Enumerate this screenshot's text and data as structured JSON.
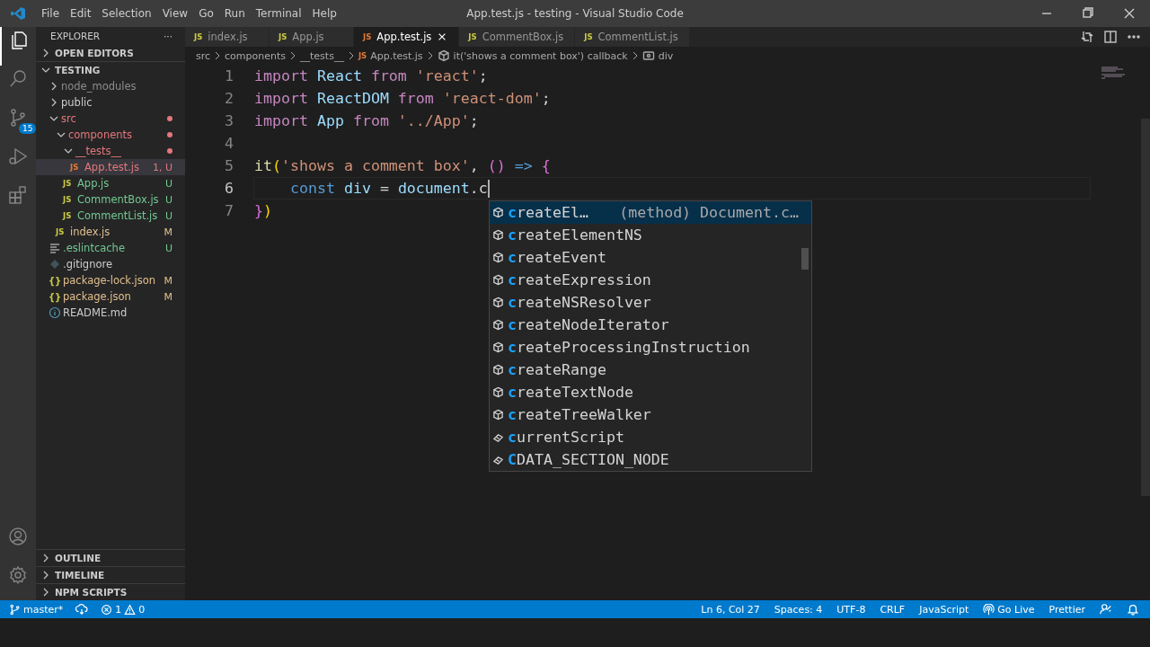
{
  "title_bar": {
    "menu": [
      "File",
      "Edit",
      "Selection",
      "View",
      "Go",
      "Run",
      "Terminal",
      "Help"
    ],
    "title": "App.test.js - testing - Visual Studio Code"
  },
  "activity_bar": {
    "items": [
      {
        "kind": "files",
        "selected": true
      },
      {
        "kind": "search",
        "selected": false
      },
      {
        "kind": "scm",
        "selected": false,
        "badge": "15"
      },
      {
        "kind": "run",
        "selected": false
      },
      {
        "kind": "extensions",
        "selected": false
      }
    ]
  },
  "sidebar": {
    "title": "EXPLORER",
    "more": "···",
    "open_editors": {
      "label": "OPEN EDITORS",
      "expanded": false
    },
    "root": {
      "label": "TESTING",
      "expanded": true,
      "children": [
        {
          "label": "node_modules",
          "kind": "folder",
          "expanded": false,
          "color": "#8c8c8c",
          "dot": false
        },
        {
          "label": "public",
          "kind": "folder",
          "expanded": false,
          "color": "#cccccc",
          "dot": false
        },
        {
          "label": "src",
          "kind": "folder",
          "expanded": true,
          "color": "#e4787c",
          "dot": true,
          "children": [
            {
              "label": "components",
              "kind": "folder",
              "expanded": true,
              "color": "#e4787c",
              "dot": true,
              "children": [
                {
                  "label": "__tests__",
                  "kind": "folder",
                  "expanded": true,
                  "color": "#e4787c",
                  "dot": true,
                  "children": [
                    {
                      "label": "App.test.js",
                      "kind": "js",
                      "icon_label": "JS",
                      "color": "#e4787c",
                      "selected": true,
                      "badge": "1, U"
                    }
                  ]
                },
                {
                  "label": "App.js",
                  "kind": "js",
                  "icon_label": "JS",
                  "color": "#73c991",
                  "selected": false,
                  "badge": "U"
                },
                {
                  "label": "CommentBox.js",
                  "kind": "js",
                  "icon_label": "JS",
                  "color": "#73c991",
                  "selected": false,
                  "badge": "U"
                },
                {
                  "label": "CommentList.js",
                  "kind": "js",
                  "icon_label": "JS",
                  "color": "#73c991",
                  "selected": false,
                  "badge": "U"
                }
              ]
            },
            {
              "label": "index.js",
              "kind": "js",
              "icon_label": "JS",
              "color": "#e2c08d",
              "selected": false,
              "badge": "M"
            }
          ]
        },
        {
          "label": ".eslintcache",
          "kind": "lines",
          "color": "#73c991",
          "selected": false,
          "badge": "U"
        },
        {
          "label": ".gitignore",
          "kind": "gitignore",
          "color": "#cccccc",
          "selected": false
        },
        {
          "label": "package-lock.json",
          "kind": "json",
          "icon_label": "{}",
          "color": "#e2c08d",
          "selected": false,
          "badge": "M"
        },
        {
          "label": "package.json",
          "kind": "json",
          "icon_label": "{}",
          "color": "#e2c08d",
          "selected": false,
          "badge": "M"
        },
        {
          "label": "README.md",
          "kind": "info",
          "color": "#cccccc",
          "selected": false
        }
      ]
    },
    "sections": [
      {
        "label": "OUTLINE",
        "expanded": false
      },
      {
        "label": "TIMELINE",
        "expanded": false
      },
      {
        "label": "NPM SCRIPTS",
        "expanded": false
      }
    ]
  },
  "tabs": [
    {
      "label": "index.js",
      "icon_label": "JS",
      "selected": false
    },
    {
      "label": "App.js",
      "icon_label": "JS",
      "selected": false
    },
    {
      "label": "App.test.js",
      "icon_label": "JS",
      "selected": true
    },
    {
      "label": "CommentBox.js",
      "icon_label": "JS",
      "selected": false
    },
    {
      "label": "CommentList.js",
      "icon_label": "JS",
      "selected": false
    }
  ],
  "breadcrumbs": [
    {
      "label": "src",
      "kind": "folder"
    },
    {
      "label": "components",
      "kind": "folder"
    },
    {
      "label": "__tests__",
      "kind": "folder"
    },
    {
      "label": "App.test.js",
      "kind": "js",
      "icon_label": "JS"
    },
    {
      "label": "it('shows a comment box') callback",
      "kind": "method"
    },
    {
      "label": "div",
      "kind": "variable"
    }
  ],
  "code": [
    {
      "number": "1",
      "current": false,
      "tokens": [
        {
          "text": "import",
          "kind": "keyword"
        },
        {
          "text": " React ",
          "kind": "variable"
        },
        {
          "text": "from",
          "kind": "keyword"
        },
        {
          "text": " 'react'",
          "kind": "string"
        },
        {
          "text": ";",
          "kind": "plain"
        }
      ]
    },
    {
      "number": "2",
      "current": false,
      "tokens": [
        {
          "text": "import",
          "kind": "keyword"
        },
        {
          "text": " ReactDOM ",
          "kind": "variable"
        },
        {
          "text": "from",
          "kind": "keyword"
        },
        {
          "text": " 'react-dom'",
          "kind": "string"
        },
        {
          "text": ";",
          "kind": "plain"
        }
      ]
    },
    {
      "number": "3",
      "current": false,
      "tokens": [
        {
          "text": "import",
          "kind": "keyword"
        },
        {
          "text": " App ",
          "kind": "variable"
        },
        {
          "text": "from",
          "kind": "keyword"
        },
        {
          "text": " '../App'",
          "kind": "string"
        },
        {
          "text": ";",
          "kind": "plain"
        }
      ]
    },
    {
      "number": "4",
      "current": false
    },
    {
      "number": "5",
      "current": false,
      "tokens": [
        {
          "text": "it",
          "kind": "function"
        },
        {
          "text": "(",
          "kind": "bracket1"
        },
        {
          "text": "'shows a comment box'",
          "kind": "string"
        },
        {
          "text": ", ",
          "kind": "plain"
        },
        {
          "text": "()",
          "kind": "bracket2"
        },
        {
          "text": " => ",
          "kind": "storage"
        },
        {
          "text": "{",
          "kind": "bracket2"
        }
      ]
    },
    {
      "number": "6",
      "current": true,
      "tokens": [
        {
          "text": "    const",
          "kind": "storage"
        },
        {
          "text": " div",
          "kind": "variable"
        },
        {
          "text": " = ",
          "kind": "plain"
        },
        {
          "text": "document",
          "kind": "variable"
        },
        {
          "text": ".c",
          "kind": "plain"
        }
      ]
    },
    {
      "number": "7",
      "current": false,
      "tokens": [
        {
          "text": "}",
          "kind": "bracket2"
        },
        {
          "text": ")",
          "kind": "bracket1"
        }
      ]
    }
  ],
  "suggestions": [
    {
      "label": "createEl…",
      "kind": "method",
      "selected": true,
      "detail": "(method) Document.c…"
    },
    {
      "label": "createElementNS",
      "kind": "method",
      "selected": false
    },
    {
      "label": "createEvent",
      "kind": "method",
      "selected": false
    },
    {
      "label": "createExpression",
      "kind": "method",
      "selected": false
    },
    {
      "label": "createNSResolver",
      "kind": "method",
      "selected": false
    },
    {
      "label": "createNodeIterator",
      "kind": "method",
      "selected": false
    },
    {
      "label": "createProcessingInstruction",
      "kind": "method",
      "selected": false
    },
    {
      "label": "createRange",
      "kind": "method",
      "selected": false
    },
    {
      "label": "createTextNode",
      "kind": "method",
      "selected": false
    },
    {
      "label": "createTreeWalker",
      "kind": "method",
      "selected": false
    },
    {
      "label": "currentScript",
      "kind": "property",
      "selected": false
    },
    {
      "label": "CDATA_SECTION_NODE",
      "kind": "property",
      "selected": false
    }
  ],
  "status_bar": {
    "branch": "master*",
    "errors": "1",
    "warnings": "0",
    "right": [
      {
        "label": "Ln 6, Col 27",
        "kind": "text"
      },
      {
        "label": "Spaces: 4",
        "kind": "text"
      },
      {
        "label": "UTF-8",
        "kind": "text"
      },
      {
        "label": "CRLF",
        "kind": "text"
      },
      {
        "label": "JavaScript",
        "kind": "text"
      },
      {
        "label": "Go Live",
        "kind": "broadcast"
      },
      {
        "label": "Prettier",
        "kind": "text"
      }
    ]
  }
}
